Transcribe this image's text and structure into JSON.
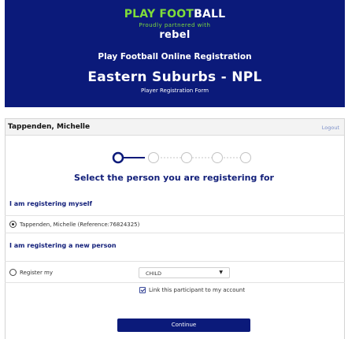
{
  "header": {
    "brand_play": "PLAY FOOT",
    "brand_ball": "BALL",
    "partner_text": "Proudly partnered with",
    "partner_name": "rebel",
    "online_title": "Play Football Online Registration",
    "club_name": "Eastern Suburbs - NPL",
    "form_name": "Player Registration Form"
  },
  "account": {
    "user_name": "Tappenden, Michelle",
    "logout_label": "Logout"
  },
  "stepper": {
    "total_steps": 5,
    "current_step": 1
  },
  "main": {
    "section_title": "Select the person you are registering for",
    "myself_heading": "I am registering myself",
    "myself_option": "Tappenden, Michelle (Reference:76824325)",
    "new_person_heading": "I am registering a new person",
    "register_my_label": "Register my",
    "relationship_value": "CHILD",
    "link_label": "Link this participant to my account",
    "continue_label": "Continue"
  },
  "colors": {
    "banner_blue": "#0b1a7a",
    "brand_green": "#7fdc3a",
    "heading_blue": "#13207a"
  }
}
